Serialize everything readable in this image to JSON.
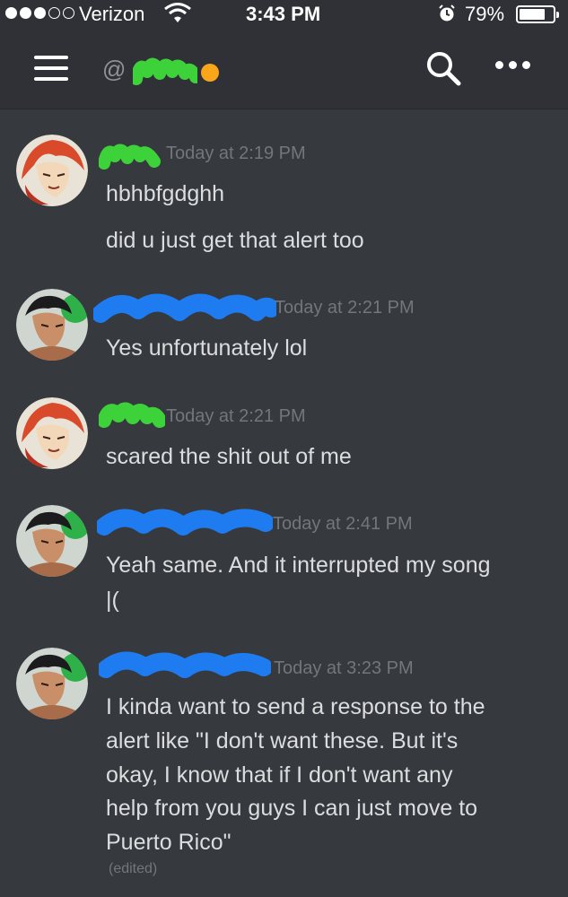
{
  "status_bar": {
    "carrier": "Verizon",
    "time": "3:43 PM",
    "battery_percent": "79%",
    "battery_level": 0.79
  },
  "header": {
    "at_prefix": "@",
    "status_color": "#faa61a"
  },
  "colors": {
    "background": "#36393e",
    "header_bg": "#2f3136",
    "redact_green": "#3dd13a",
    "redact_blue": "#1f7cf0",
    "text": "#dcddde",
    "muted": "#72767d"
  },
  "messages": [
    {
      "avatar": "orange-hair-avatar",
      "timestamp": "Today at 2:19 PM",
      "lines": [
        "hbhbfgdghh",
        "did u just get that alert too"
      ]
    },
    {
      "avatar": "boxer-avatar",
      "timestamp": "Today at 2:21 PM",
      "lines": [
        "Yes unfortunately lol"
      ]
    },
    {
      "avatar": "orange-hair-avatar",
      "timestamp": "Today at 2:21 PM",
      "lines": [
        "scared the shit out of me"
      ]
    },
    {
      "avatar": "boxer-avatar",
      "timestamp": "Today at 2:41 PM",
      "lines": [
        "Yeah same. And it interrupted my song",
        "|("
      ]
    },
    {
      "avatar": "boxer-avatar",
      "timestamp": "Today at 3:23 PM",
      "lines": [
        "I kinda want to send a response to the",
        "alert like \"I don't want these. But it's",
        "okay, I know that if I don't want any",
        "help from you guys I can just move to",
        "Puerto Rico\""
      ],
      "edited": "(edited)"
    }
  ]
}
